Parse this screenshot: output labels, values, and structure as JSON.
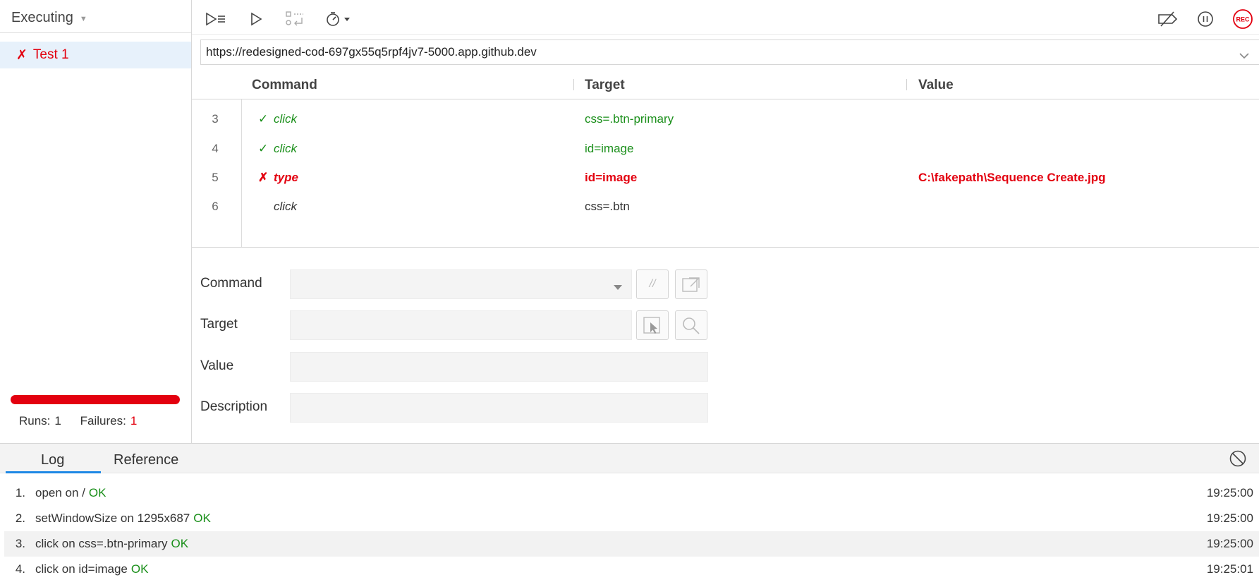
{
  "sidebar": {
    "header": "Executing",
    "test_status_icon": "✗",
    "test_name": "Test 1",
    "runs_label": "Runs:",
    "runs_value": "1",
    "failures_label": "Failures:",
    "failures_value": "1",
    "progress": 1.0,
    "progress_color": "#e3000f"
  },
  "toolbar": {
    "icons": [
      "run-all-icon",
      "run-icon",
      "step-over-icon",
      "speed-icon",
      "disable-breakpoints-icon",
      "pause-icon",
      "record-icon"
    ],
    "rec_label": "REC"
  },
  "url_bar": {
    "value": "https://redesigned-cod-697gx55q5rpf4jv7-5000.app.github.dev"
  },
  "table": {
    "headers": {
      "command": "Command",
      "target": "Target",
      "value": "Value"
    },
    "rows": [
      {
        "num": "3",
        "status": "✓",
        "command": "click",
        "target": "css=.btn-primary",
        "value": ""
      },
      {
        "num": "4",
        "status": "✓",
        "command": "click",
        "target": "id=image",
        "value": ""
      },
      {
        "num": "5",
        "status": "✗",
        "command": "type",
        "target": "id=image",
        "value": "C:\\fakepath\\Sequence Create.jpg"
      },
      {
        "num": "6",
        "status": "",
        "command": "click",
        "target": "css=.btn",
        "value": ""
      }
    ]
  },
  "editor": {
    "command_label": "Command",
    "target_label": "Target",
    "value_label": "Value",
    "description_label": "Description"
  },
  "bottom": {
    "tabs": [
      "Log",
      "Reference"
    ],
    "log": [
      {
        "idx": "1.",
        "text": "open on /",
        "status": "OK",
        "time": "19:25:00"
      },
      {
        "idx": "2.",
        "text": "setWindowSize on 1295x687",
        "status": "OK",
        "time": "19:25:00"
      },
      {
        "idx": "3.",
        "text": "click on css=.btn-primary",
        "status": "OK",
        "time": "19:25:00"
      },
      {
        "idx": "4.",
        "text": "click on id=image",
        "status": "OK",
        "time": "19:25:01"
      }
    ]
  },
  "colors": {
    "ok": "#1a8f1a",
    "fail": "#e3000f",
    "accent": "#1e88e5"
  }
}
